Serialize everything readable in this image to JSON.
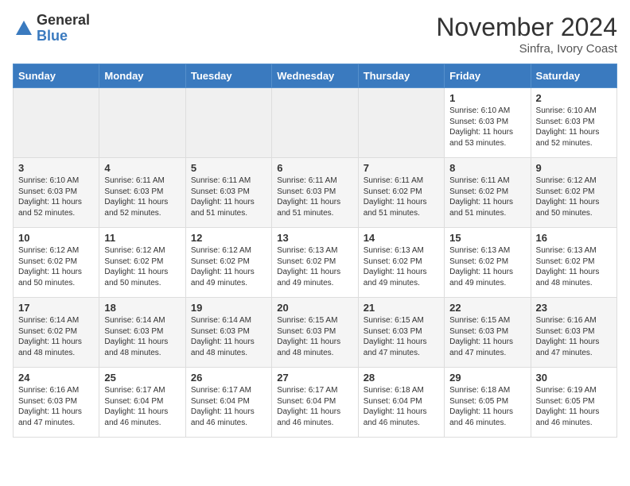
{
  "logo": {
    "general": "General",
    "blue": "Blue"
  },
  "title": "November 2024",
  "location": "Sinfra, Ivory Coast",
  "weekdays": [
    "Sunday",
    "Monday",
    "Tuesday",
    "Wednesday",
    "Thursday",
    "Friday",
    "Saturday"
  ],
  "weeks": [
    [
      {
        "day": "",
        "info": ""
      },
      {
        "day": "",
        "info": ""
      },
      {
        "day": "",
        "info": ""
      },
      {
        "day": "",
        "info": ""
      },
      {
        "day": "",
        "info": ""
      },
      {
        "day": "1",
        "info": "Sunrise: 6:10 AM\nSunset: 6:03 PM\nDaylight: 11 hours\nand 53 minutes."
      },
      {
        "day": "2",
        "info": "Sunrise: 6:10 AM\nSunset: 6:03 PM\nDaylight: 11 hours\nand 52 minutes."
      }
    ],
    [
      {
        "day": "3",
        "info": "Sunrise: 6:10 AM\nSunset: 6:03 PM\nDaylight: 11 hours\nand 52 minutes."
      },
      {
        "day": "4",
        "info": "Sunrise: 6:11 AM\nSunset: 6:03 PM\nDaylight: 11 hours\nand 52 minutes."
      },
      {
        "day": "5",
        "info": "Sunrise: 6:11 AM\nSunset: 6:03 PM\nDaylight: 11 hours\nand 51 minutes."
      },
      {
        "day": "6",
        "info": "Sunrise: 6:11 AM\nSunset: 6:03 PM\nDaylight: 11 hours\nand 51 minutes."
      },
      {
        "day": "7",
        "info": "Sunrise: 6:11 AM\nSunset: 6:02 PM\nDaylight: 11 hours\nand 51 minutes."
      },
      {
        "day": "8",
        "info": "Sunrise: 6:11 AM\nSunset: 6:02 PM\nDaylight: 11 hours\nand 51 minutes."
      },
      {
        "day": "9",
        "info": "Sunrise: 6:12 AM\nSunset: 6:02 PM\nDaylight: 11 hours\nand 50 minutes."
      }
    ],
    [
      {
        "day": "10",
        "info": "Sunrise: 6:12 AM\nSunset: 6:02 PM\nDaylight: 11 hours\nand 50 minutes."
      },
      {
        "day": "11",
        "info": "Sunrise: 6:12 AM\nSunset: 6:02 PM\nDaylight: 11 hours\nand 50 minutes."
      },
      {
        "day": "12",
        "info": "Sunrise: 6:12 AM\nSunset: 6:02 PM\nDaylight: 11 hours\nand 49 minutes."
      },
      {
        "day": "13",
        "info": "Sunrise: 6:13 AM\nSunset: 6:02 PM\nDaylight: 11 hours\nand 49 minutes."
      },
      {
        "day": "14",
        "info": "Sunrise: 6:13 AM\nSunset: 6:02 PM\nDaylight: 11 hours\nand 49 minutes."
      },
      {
        "day": "15",
        "info": "Sunrise: 6:13 AM\nSunset: 6:02 PM\nDaylight: 11 hours\nand 49 minutes."
      },
      {
        "day": "16",
        "info": "Sunrise: 6:13 AM\nSunset: 6:02 PM\nDaylight: 11 hours\nand 48 minutes."
      }
    ],
    [
      {
        "day": "17",
        "info": "Sunrise: 6:14 AM\nSunset: 6:02 PM\nDaylight: 11 hours\nand 48 minutes."
      },
      {
        "day": "18",
        "info": "Sunrise: 6:14 AM\nSunset: 6:03 PM\nDaylight: 11 hours\nand 48 minutes."
      },
      {
        "day": "19",
        "info": "Sunrise: 6:14 AM\nSunset: 6:03 PM\nDaylight: 11 hours\nand 48 minutes."
      },
      {
        "day": "20",
        "info": "Sunrise: 6:15 AM\nSunset: 6:03 PM\nDaylight: 11 hours\nand 48 minutes."
      },
      {
        "day": "21",
        "info": "Sunrise: 6:15 AM\nSunset: 6:03 PM\nDaylight: 11 hours\nand 47 minutes."
      },
      {
        "day": "22",
        "info": "Sunrise: 6:15 AM\nSunset: 6:03 PM\nDaylight: 11 hours\nand 47 minutes."
      },
      {
        "day": "23",
        "info": "Sunrise: 6:16 AM\nSunset: 6:03 PM\nDaylight: 11 hours\nand 47 minutes."
      }
    ],
    [
      {
        "day": "24",
        "info": "Sunrise: 6:16 AM\nSunset: 6:03 PM\nDaylight: 11 hours\nand 47 minutes."
      },
      {
        "day": "25",
        "info": "Sunrise: 6:17 AM\nSunset: 6:04 PM\nDaylight: 11 hours\nand 46 minutes."
      },
      {
        "day": "26",
        "info": "Sunrise: 6:17 AM\nSunset: 6:04 PM\nDaylight: 11 hours\nand 46 minutes."
      },
      {
        "day": "27",
        "info": "Sunrise: 6:17 AM\nSunset: 6:04 PM\nDaylight: 11 hours\nand 46 minutes."
      },
      {
        "day": "28",
        "info": "Sunrise: 6:18 AM\nSunset: 6:04 PM\nDaylight: 11 hours\nand 46 minutes."
      },
      {
        "day": "29",
        "info": "Sunrise: 6:18 AM\nSunset: 6:05 PM\nDaylight: 11 hours\nand 46 minutes."
      },
      {
        "day": "30",
        "info": "Sunrise: 6:19 AM\nSunset: 6:05 PM\nDaylight: 11 hours\nand 46 minutes."
      }
    ]
  ]
}
